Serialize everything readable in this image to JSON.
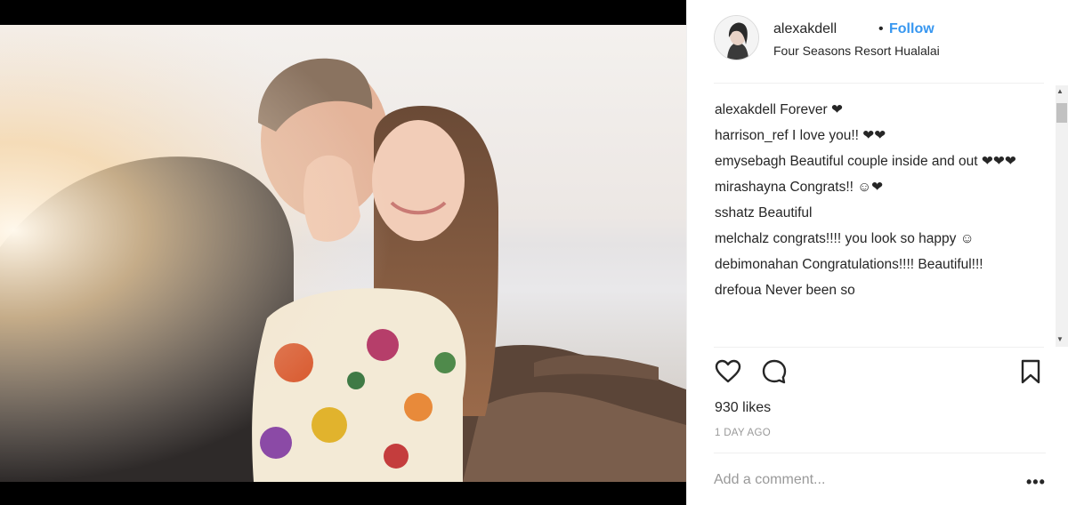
{
  "post": {
    "username": "alexakdell",
    "separator": "•",
    "follow_label": "Follow",
    "location": "Four Seasons Resort Hualalai"
  },
  "comments": [
    {
      "user": "alexakdell",
      "text": "Forever ❤"
    },
    {
      "user": "harrison_ref",
      "text": "I love you!! ❤❤"
    },
    {
      "user": "emysebagh",
      "text": "Beautiful couple inside and out ❤❤❤"
    },
    {
      "user": "mirashayna",
      "text": "Congrats!! ☺❤"
    },
    {
      "user": "sshatz",
      "text": "Beautiful"
    },
    {
      "user": "melchalz",
      "text": "congrats!!!! you look so happy ☺"
    },
    {
      "user": "debimonahan",
      "text": "Congratulations!!!! Beautiful!!!"
    },
    {
      "user": "drefoua",
      "text": "Never been so"
    }
  ],
  "actions": {
    "like_icon": "heart-outline-icon",
    "comment_icon": "comment-bubble-icon",
    "save_icon": "bookmark-icon"
  },
  "likes_label": "930 likes",
  "timestamp": "1 DAY AGO",
  "add_comment_placeholder": "Add a comment...",
  "more_label": "•••",
  "colors": {
    "follow": "#3897f0",
    "text": "#262626",
    "muted": "#999999"
  }
}
